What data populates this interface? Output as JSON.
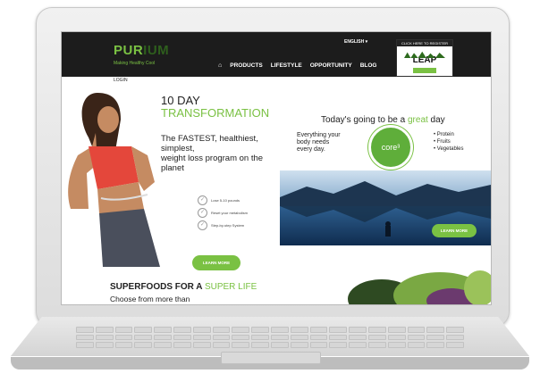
{
  "header": {
    "logo_left": "PUR",
    "logo_right": "IUM",
    "tagline": "Making Healthy Cool",
    "language": "ENGLISH ▾",
    "nav": [
      {
        "label": "⌂"
      },
      {
        "label": "PRODUCTS"
      },
      {
        "label": "LIFESTYLE"
      },
      {
        "label": "OPPORTUNITY"
      },
      {
        "label": "BLOG"
      }
    ],
    "register_text": "CLICK HERE TO REGISTER",
    "register_brand": "LEAP"
  },
  "left": {
    "login": "LOGIN",
    "title_line1": "10 DAY",
    "title_line2": "TRANSFORMATION",
    "headline_1": "The FASTEST, healthiest,",
    "headline_2": "simplest,",
    "headline_3": "weight loss program on the",
    "headline_4": "planet",
    "checklist": [
      {
        "text": "Lose 5-10 pounds"
      },
      {
        "text": "Reset your metabolism"
      },
      {
        "text": "Step-by-step System"
      }
    ],
    "learn_more": "LEARN MORE",
    "superfoods_1": "SUPERFOODS FOR A ",
    "superfoods_2": "SUPER LIFE",
    "choose": "Choose from more than"
  },
  "right": {
    "great_day_1": "Today's going to be a ",
    "great_day_2": "great",
    "great_day_3": " day",
    "body_needs_1": "Everything your",
    "body_needs_2": "body needs",
    "body_needs_3": "every day.",
    "core": "core³",
    "bullets": [
      {
        "text": "• Protein"
      },
      {
        "text": "• Fruits"
      },
      {
        "text": "• Vegetables"
      }
    ],
    "learn_more": "LEARN MORE"
  },
  "colors": {
    "brand_green": "#7ac143",
    "header_bg": "#1c1c1c"
  }
}
